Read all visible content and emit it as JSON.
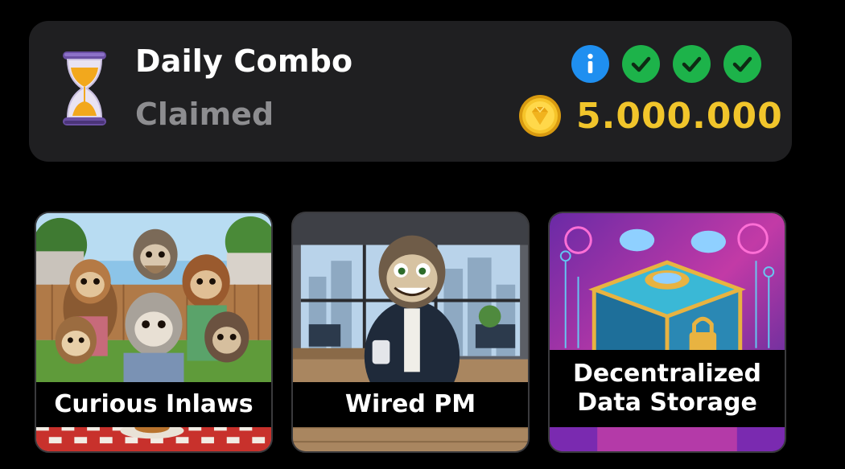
{
  "daily_combo": {
    "title": "Daily Combo",
    "status": "Claimed",
    "reward": "5.000.000",
    "icons": [
      "hourglass-icon",
      "info-icon",
      "check-icon",
      "check-icon",
      "check-icon",
      "coin-icon"
    ],
    "colors": {
      "panel": "#1f1f21",
      "reward": "#f1c52b",
      "status": "#8d8d90",
      "info": "#1f8ff0",
      "check": "#1db34a"
    }
  },
  "cards": [
    {
      "label": "Curious Inlaws"
    },
    {
      "label": "Wired PM"
    },
    {
      "label": "Decentralized Data Storage"
    }
  ]
}
